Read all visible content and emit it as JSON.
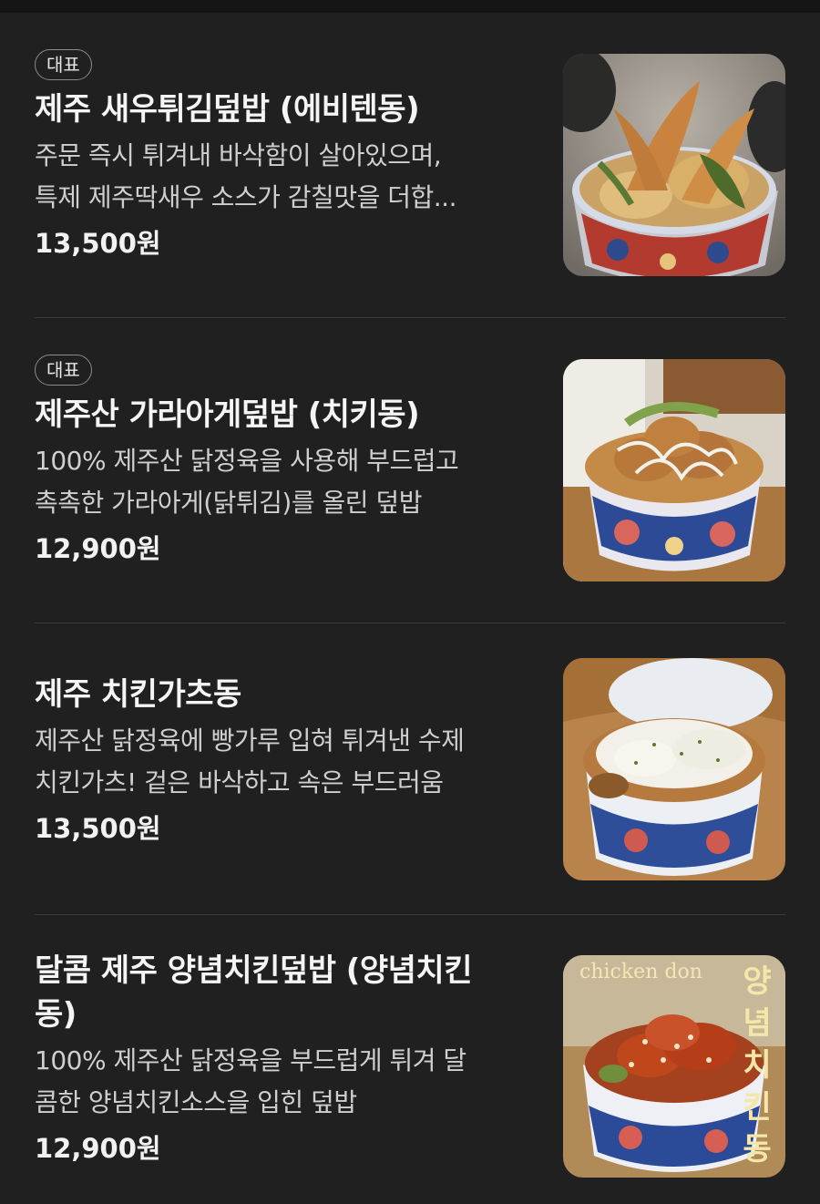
{
  "menu": {
    "items": [
      {
        "badge": "대표",
        "name": "제주 새우튀김덮밥 (에비텐동)",
        "desc_line1": "주문 즉시 튀겨내 바삭함이 살아있으며,",
        "desc_line2": "특제 제주딱새우 소스가 감칠맛을 더합...",
        "price": "13,500원",
        "photo_icon": "tempura-shrimp-bowl-photo"
      },
      {
        "badge": "대표",
        "name": "제주산 가라아게덮밥 (치키동)",
        "desc_line1": "100% 제주산 닭정육을 사용해 부드럽고",
        "desc_line2": "촉촉한 가라아게(닭튀김)를 올린 덮밥",
        "price": "12,900원",
        "photo_icon": "karaage-chicken-bowl-photo"
      },
      {
        "name": "제주 치킨가츠동",
        "desc_line1": "제주산 닭정육에 빵가루 입혀 튀겨낸 수제",
        "desc_line2": "치킨가츠! 겉은 바삭하고 속은 부드러움",
        "price": "13,500원",
        "photo_icon": "chicken-katsu-bowl-photo"
      },
      {
        "name_line1": "달콤 제주 양념치킨덮밥 (양념치킨",
        "name_line2": "동)",
        "desc_line1": "100% 제주산 닭정육을 부드럽게 튀겨 달",
        "desc_line2": "콤한 양념치킨소스을 입힌 덮밥",
        "price": "12,900원",
        "photo_icon": "yangnyeom-chicken-bowl-photo",
        "photo_caption_latin": "chicken don",
        "photo_caption_vertical": [
          "양",
          "념",
          "치",
          "킨",
          "동"
        ]
      }
    ]
  },
  "colors": {
    "background": "#202020",
    "divider": "#3a3a3a",
    "text_primary": "#f5f5f5",
    "text_secondary": "#cfcfcf",
    "badge_border": "#8a8a8a"
  }
}
